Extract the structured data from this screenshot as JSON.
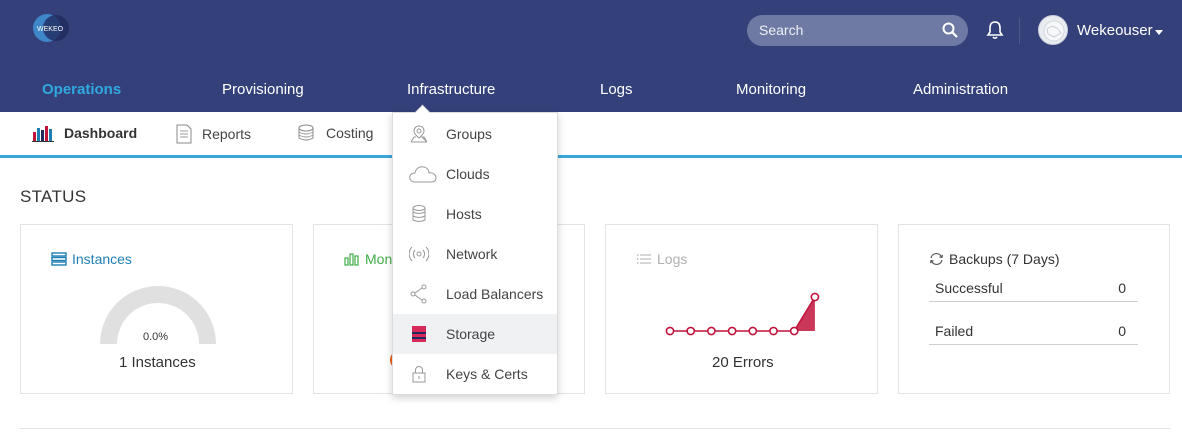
{
  "header": {
    "logo_text": "WEKEO",
    "search_placeholder": "Search",
    "username": "Wekeouser"
  },
  "mainnav": {
    "items": [
      "Operations",
      "Provisioning",
      "Infrastructure",
      "Logs",
      "Monitoring",
      "Administration"
    ]
  },
  "subnav": {
    "items": [
      "Dashboard",
      "Reports",
      "Costing"
    ]
  },
  "status": {
    "title": "STATUS",
    "instances": {
      "title": "Instances",
      "gauge_value": "0.0%",
      "summary": "1 Instances"
    },
    "monitoring": {
      "title_partial": "Mon"
    },
    "logs": {
      "title": "Logs",
      "summary": "20 Errors",
      "series": [
        0,
        0,
        0,
        0,
        0,
        0,
        0,
        1
      ]
    },
    "backups": {
      "title": "Backups (7 Days)",
      "rows": [
        {
          "label": "Successful",
          "value": "0"
        },
        {
          "label": "Failed",
          "value": "0"
        }
      ]
    }
  },
  "dropdown": {
    "items": [
      "Groups",
      "Clouds",
      "Hosts",
      "Network",
      "Load Balancers",
      "Storage",
      "Keys & Certs"
    ],
    "hovered": "Storage"
  },
  "colors": {
    "header_bg": "#34407a",
    "active_nav": "#2fa9e0",
    "accent_line": "#38a8d8",
    "logs_line": "#c0143c",
    "monitoring_green": "#3fae49",
    "instances_blue": "#1f7fb5"
  }
}
